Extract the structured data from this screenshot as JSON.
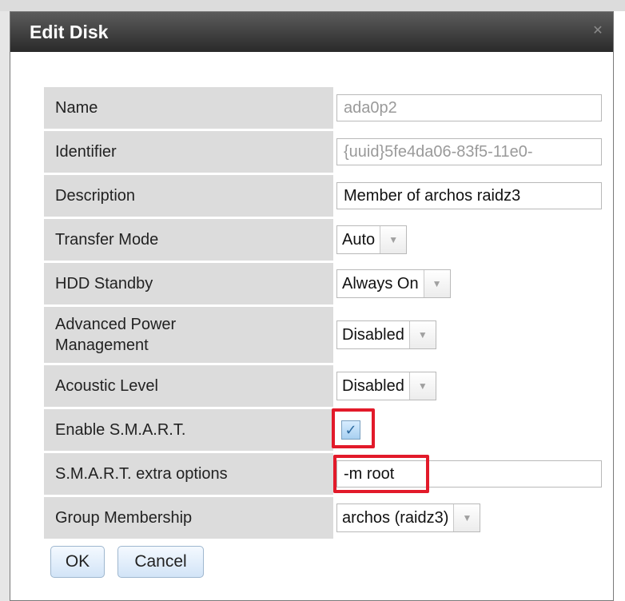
{
  "dialog": {
    "title": "Edit Disk",
    "close_icon": "close-icon"
  },
  "fields": {
    "name": {
      "label": "Name",
      "value": "ada0p2",
      "disabled": true
    },
    "identifier": {
      "label": "Identifier",
      "value": "{uuid}5fe4da06-83f5-11e0-",
      "disabled": true
    },
    "description": {
      "label": "Description",
      "value": "Member of archos raidz3"
    },
    "transfer_mode": {
      "label": "Transfer Mode",
      "value": "Auto"
    },
    "hdd_standby": {
      "label": "HDD Standby",
      "value": "Always On"
    },
    "advanced_power": {
      "label_line1": "Advanced Power",
      "label_line2": "Management",
      "value": "Disabled"
    },
    "acoustic_level": {
      "label": "Acoustic Level",
      "value": "Disabled"
    },
    "enable_smart": {
      "label": "Enable S.M.A.R.T.",
      "checked": true
    },
    "smart_options": {
      "label": "S.M.A.R.T. extra options",
      "value": "-m root"
    },
    "group_membership": {
      "label": "Group Membership",
      "value": "archos (raidz3)"
    }
  },
  "buttons": {
    "ok": "OK",
    "cancel": "Cancel"
  },
  "colors": {
    "highlight": "#e21a2a",
    "label_bg": "#dcdcdc",
    "titlebar": "#3a3a3a"
  }
}
